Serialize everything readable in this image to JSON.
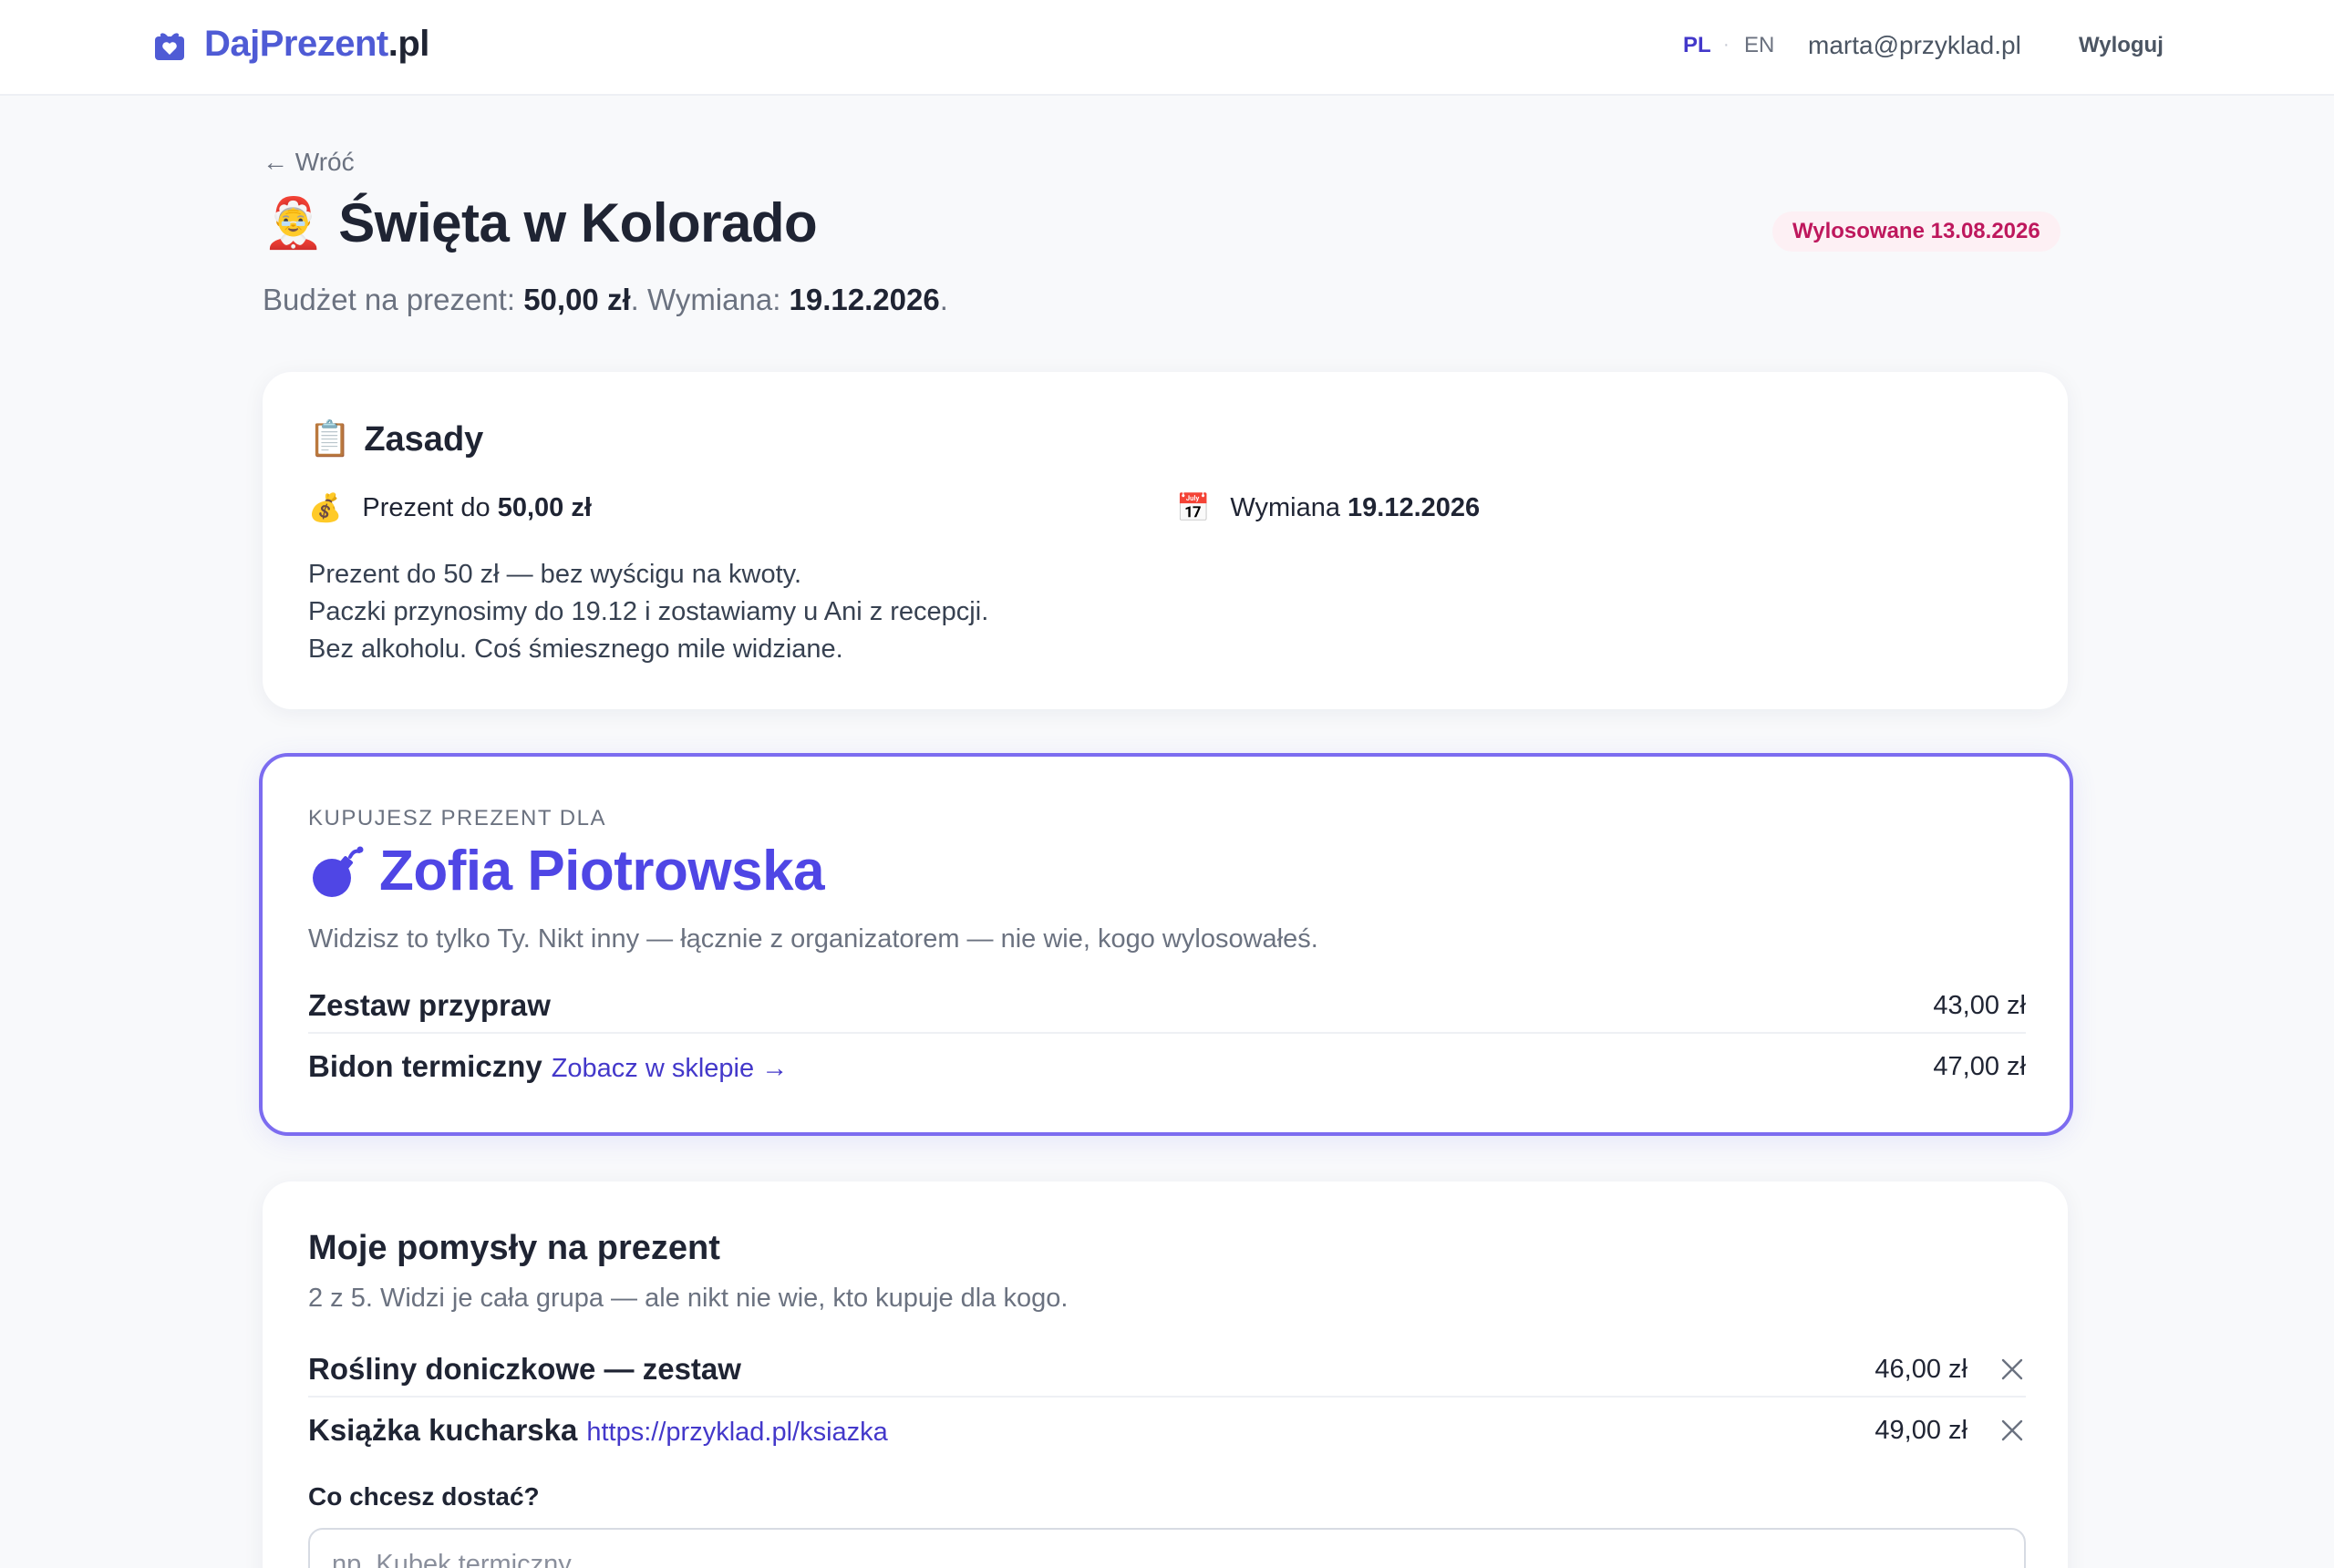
{
  "brand": {
    "name": "DajPrezent",
    "tld": ".pl",
    "icon": "gift-icon",
    "color": "#4f5bd5"
  },
  "nav": {
    "lang_pl": "PL",
    "lang_en": "EN",
    "separator": "·",
    "user_email": "marta@przyklad.pl",
    "logout": "Wyloguj"
  },
  "header": {
    "back_label": "← Wróć",
    "emoji": "🤶",
    "title": "Święta w Kolorado",
    "badge": "Wylosowane 13.08.2026",
    "subtitle": {
      "budget_label": "Budżet na prezent: ",
      "budget_value": "50,00 zł",
      "exchange_label": ". Wymiana: ",
      "exchange_value": "19.12.2026",
      "end": "."
    }
  },
  "rules": {
    "emoji": "📋",
    "title": "Zasady",
    "budget": {
      "emoji": "💰",
      "label": "Prezent do ",
      "value": "50,00 zł"
    },
    "exchange": {
      "emoji": "📅",
      "label": "Wymiana ",
      "value": "19.12.2026"
    },
    "lines": [
      "Prezent do 50 zł — bez wyścigu na kwoty.",
      "Paczki przynosimy do 19.12 i zostawiamy u Ani z recepcji.",
      "Bez alkoholu. Coś śmiesznego mile widziane."
    ]
  },
  "recipient": {
    "kicker": "KUPUJESZ PREZENT DLA",
    "icon": "bomb-icon",
    "name": "Zofia Piotrowska",
    "note": "Widzisz to tylko Ty. Nikt inny — łącznie z organizatorem — nie wie, kogo wylosowałeś.",
    "wishlist": [
      {
        "name": "Zestaw przypraw",
        "link": "",
        "price": "43,00 zł"
      },
      {
        "name": "Bidon termiczny",
        "link": "Zobacz w sklepie →",
        "price": "47,00 zł"
      }
    ]
  },
  "ideas": {
    "title": "Moje pomysły na prezent",
    "subtitle": "2 z 5. Widzi je cała grupa — ale nikt nie wie, kto kupuje dla kogo.",
    "items": [
      {
        "name": "Rośliny doniczkowe — zestaw",
        "link": "",
        "price": "46,00 zł"
      },
      {
        "name": "Książka kucharska",
        "link": "https://przyklad.pl/ksiazka",
        "price": "49,00 zł"
      }
    ],
    "field_label": "Co chcesz dostać?",
    "field_placeholder": "np. Kubek termiczny"
  },
  "colors": {
    "accent": "#4f46e5",
    "badge_bg": "#fdf0f4",
    "badge_text": "#be185d",
    "link": "#4338ca"
  }
}
